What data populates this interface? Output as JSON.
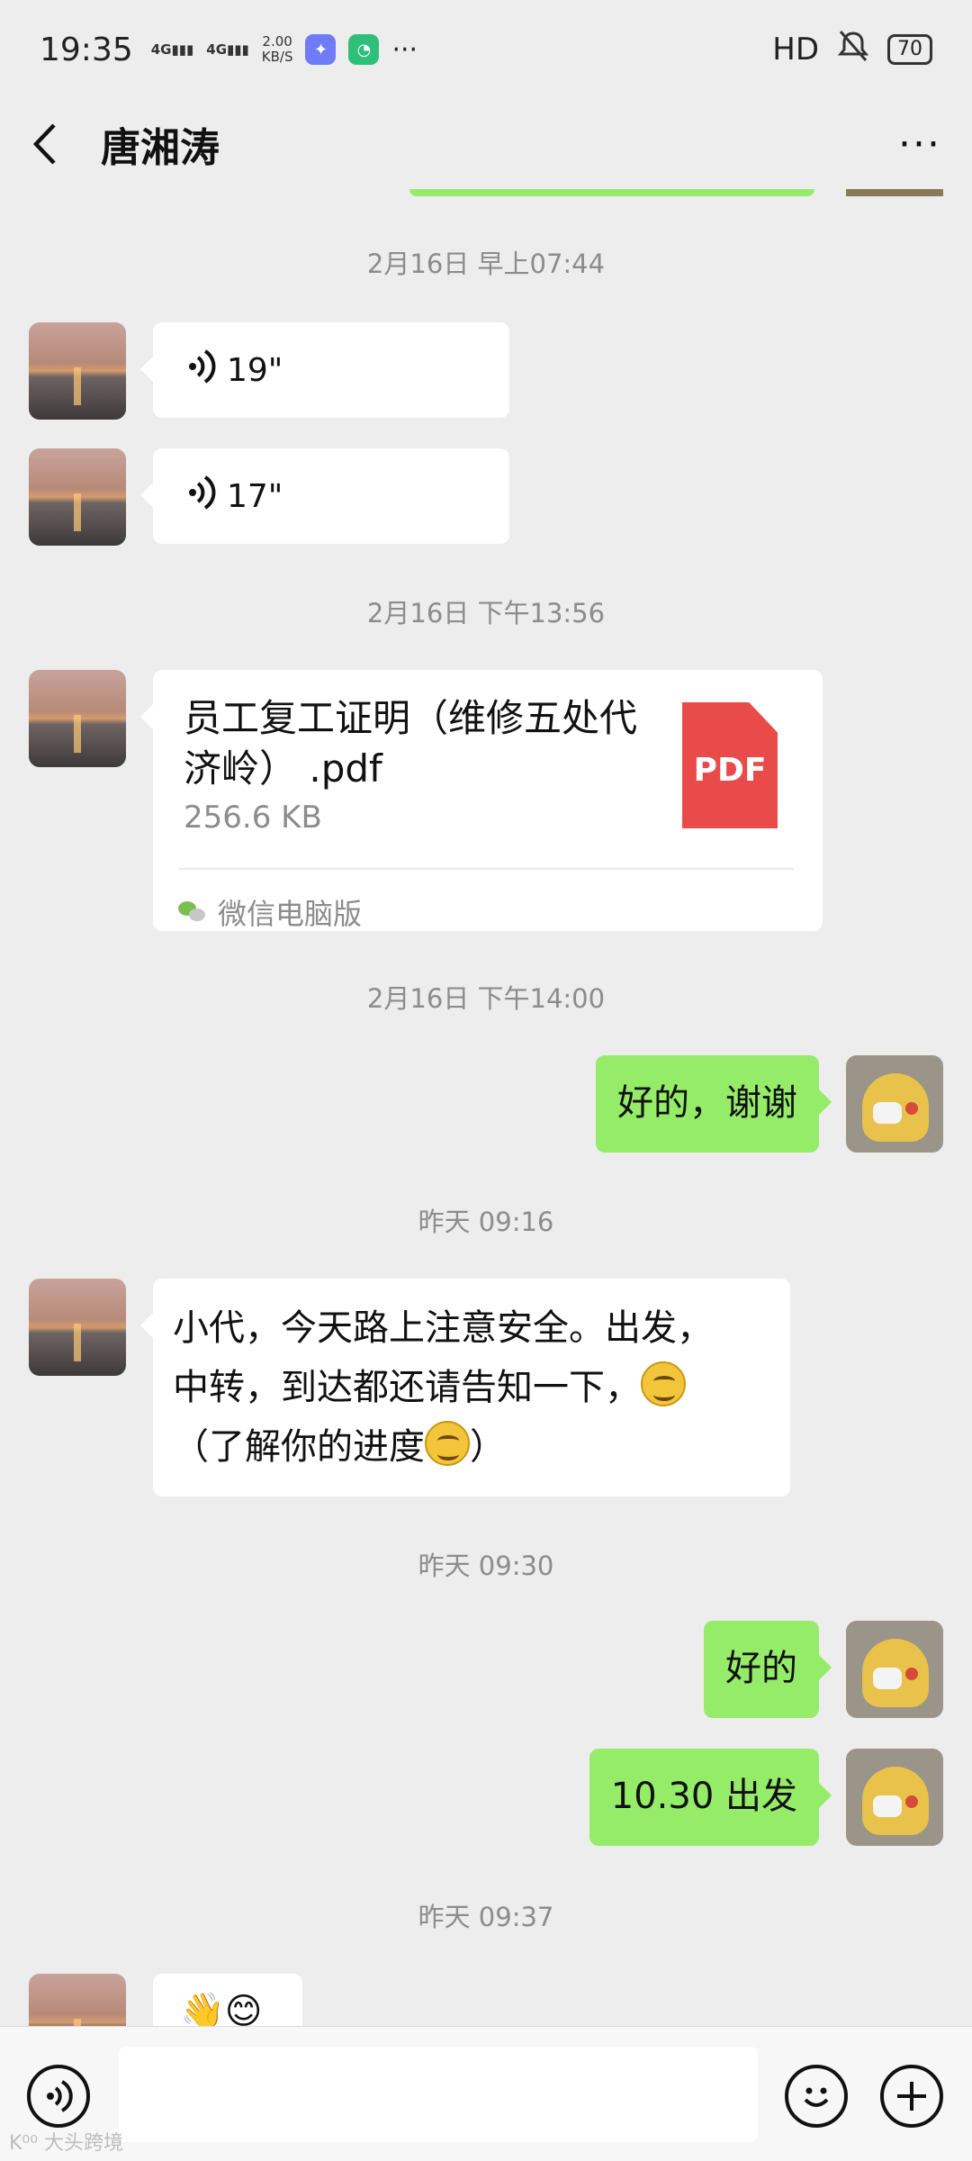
{
  "status_bar": {
    "time": "19:35",
    "signal1": "4G",
    "signal2": "4G",
    "net_speed_value": "2.00",
    "net_speed_unit": "KB/S",
    "more": "···",
    "hd": "HD",
    "battery": "70",
    "icons": [
      "signal-icon",
      "app-icon",
      "app-icon",
      "mute-icon",
      "battery-icon"
    ]
  },
  "header": {
    "title": "唐湘涛",
    "back_icon": "chevron-left-icon",
    "more_label": "···"
  },
  "timestamps": {
    "t1": "2月16日 早上07:44",
    "t2": "2月16日 下午13:56",
    "t3": "2月16日 下午14:00",
    "t4": "昨天 09:16",
    "t5": "昨天 09:30",
    "t6": "昨天 09:37"
  },
  "messages": {
    "voice1": "19\"",
    "voice2": "17\"",
    "file": {
      "name": "员工复工证明（维修五处代济岭） .pdf",
      "size": "256.6 KB",
      "type_badge": "PDF",
      "source": "微信电脑版"
    },
    "reply1": "好的，谢谢",
    "long_line1": "小代，今天路上注意安全。出发，",
    "long_line2": "中转，到达都还请告知一下，",
    "long_line3a": "（了解你的进度",
    "long_line3b": "）",
    "reply2": "好的",
    "reply3": "10.30 出发",
    "partial": "👋😊"
  },
  "input_bar": {
    "voice_icon": "voice-icon",
    "emoji_icon": "emoji-icon",
    "plus_icon": "plus-icon"
  },
  "watermark": "K⁰⁰ 大头跨境"
}
